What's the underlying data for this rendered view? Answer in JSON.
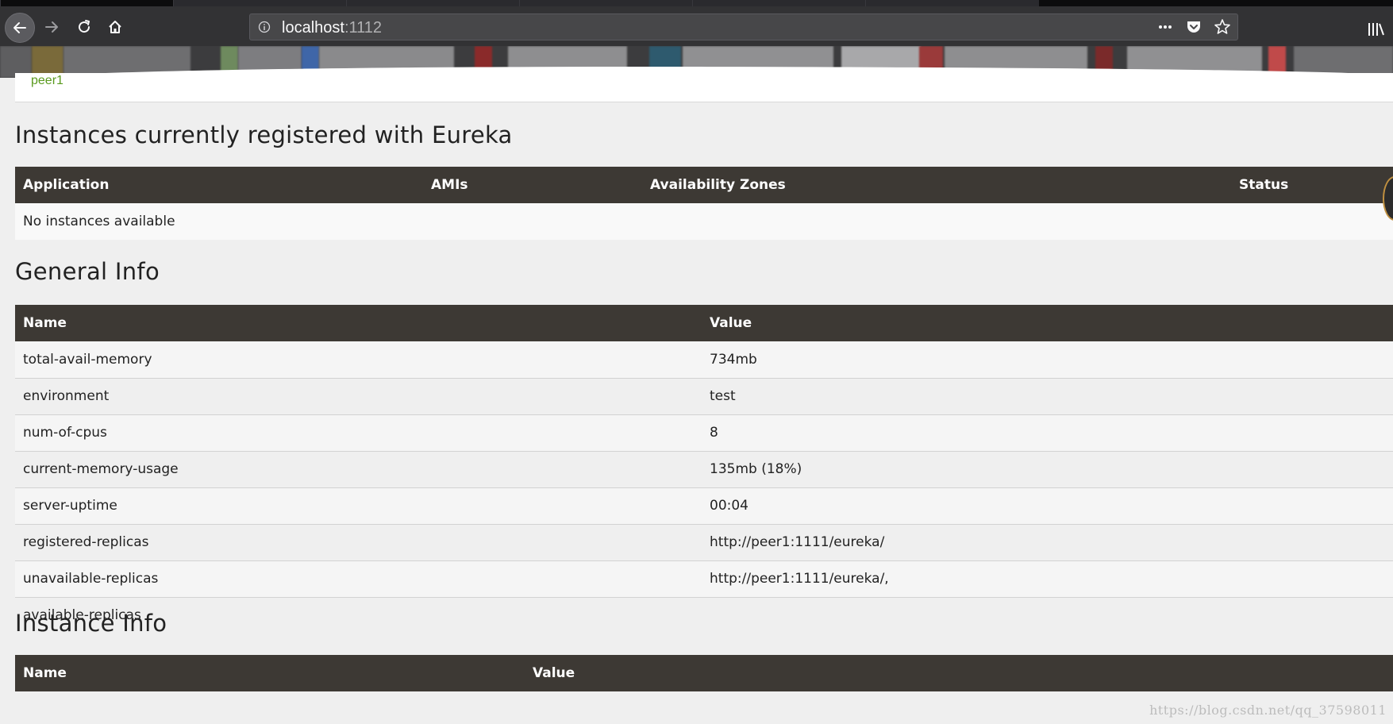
{
  "browser": {
    "url_host": "localhost",
    "url_port": ":1112",
    "colors": {
      "chrome_bg": "#323234",
      "urlbar_bg": "#474749"
    }
  },
  "page": {
    "peer_link": "peer1",
    "instances_section": {
      "title": "Instances currently registered with Eureka",
      "columns": [
        "Application",
        "AMIs",
        "Availability Zones",
        "Status"
      ],
      "empty_message": "No instances available"
    },
    "general_info": {
      "title": "General Info",
      "columns": [
        "Name",
        "Value"
      ],
      "rows": [
        {
          "name": "total-avail-memory",
          "value": "734mb"
        },
        {
          "name": "environment",
          "value": "test"
        },
        {
          "name": "num-of-cpus",
          "value": "8"
        },
        {
          "name": "current-memory-usage",
          "value": "135mb (18%)"
        },
        {
          "name": "server-uptime",
          "value": "00:04"
        },
        {
          "name": "registered-replicas",
          "value": "http://peer1:1111/eureka/"
        },
        {
          "name": "unavailable-replicas",
          "value": "http://peer1:1111/eureka/,"
        },
        {
          "name": "available-replicas",
          "value": ""
        }
      ]
    },
    "instance_info": {
      "title": "Instance Info",
      "columns": [
        "Name",
        "Value"
      ]
    },
    "colors": {
      "table_header_bg": "#3d3934",
      "link_green": "#5a9a1e",
      "page_bg": "#efefef"
    }
  },
  "watermark": "https://blog.csdn.net/qq_37598011"
}
